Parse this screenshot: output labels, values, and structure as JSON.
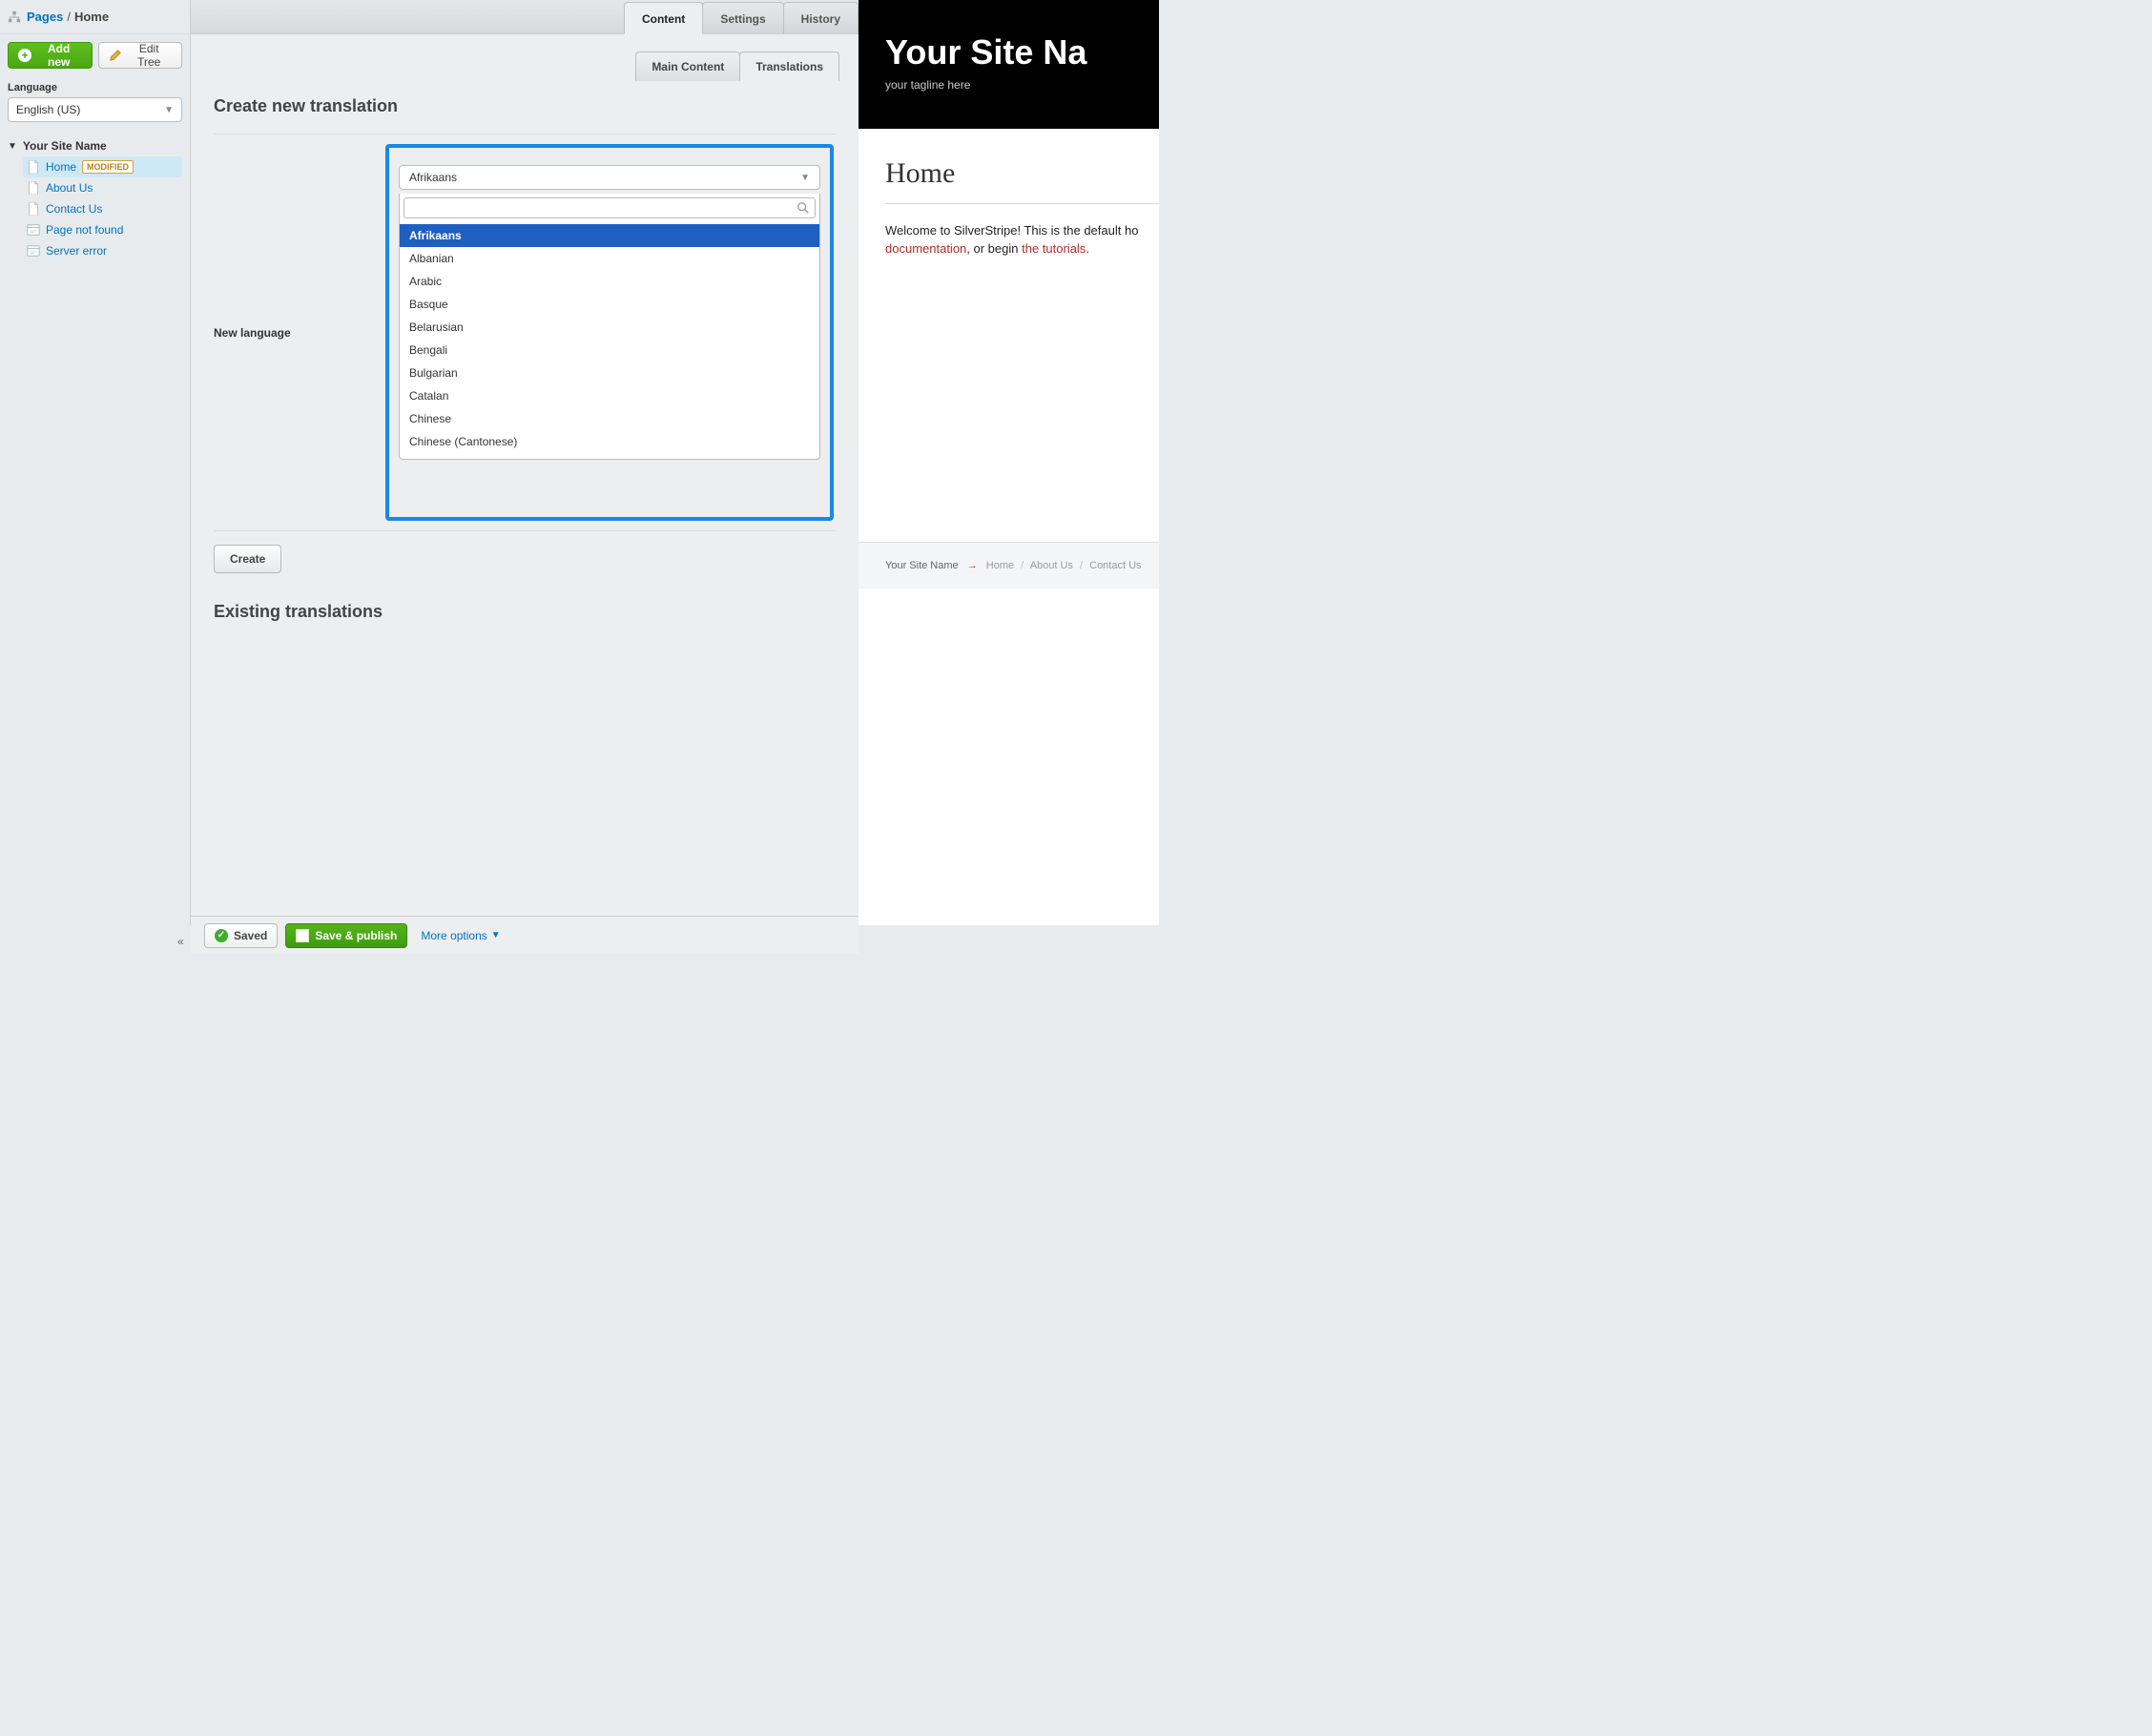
{
  "breadcrumb": {
    "root": "Pages",
    "current": "Home"
  },
  "sidebar": {
    "add_new": "Add new",
    "edit_tree": "Edit Tree",
    "language_label": "Language",
    "language_value": "English (US)",
    "site_name": "Your Site Name",
    "items": [
      {
        "label": "Home",
        "badge": "MODIFIED",
        "selected": true,
        "icon": "page"
      },
      {
        "label": "About Us",
        "icon": "page"
      },
      {
        "label": "Contact Us",
        "icon": "page"
      },
      {
        "label": "Page not found",
        "icon": "notfound"
      },
      {
        "label": "Server error",
        "icon": "server"
      }
    ]
  },
  "top_tabs": [
    {
      "label": "Content",
      "active": true
    },
    {
      "label": "Settings"
    },
    {
      "label": "History"
    }
  ],
  "sub_tabs": [
    {
      "label": "Main Content"
    },
    {
      "label": "Translations",
      "active": true
    }
  ],
  "translations": {
    "heading": "Create new translation",
    "new_language_label": "New language",
    "create_button": "Create",
    "existing_heading": "Existing translations",
    "selected_language": "Afrikaans",
    "options": [
      "Afrikaans",
      "Albanian",
      "Arabic",
      "Basque",
      "Belarusian",
      "Bengali",
      "Bulgarian",
      "Catalan",
      "Chinese",
      "Chinese (Cantonese)"
    ]
  },
  "preview": {
    "site_name": "Your Site Na",
    "tagline": "your tagline here",
    "page_title": "Home",
    "welcome_a": "Welcome to SilverStripe! This is the default ho",
    "link_doc": "documentation",
    "mid": ", or begin ",
    "link_tut": "the tutorials",
    "dot": ".",
    "footer_site": "Your Site Name",
    "footer_links": [
      "Home",
      "About Us",
      "Contact Us"
    ]
  },
  "bottom": {
    "saved": "Saved",
    "save_publish": "Save & publish",
    "more": "More options"
  }
}
